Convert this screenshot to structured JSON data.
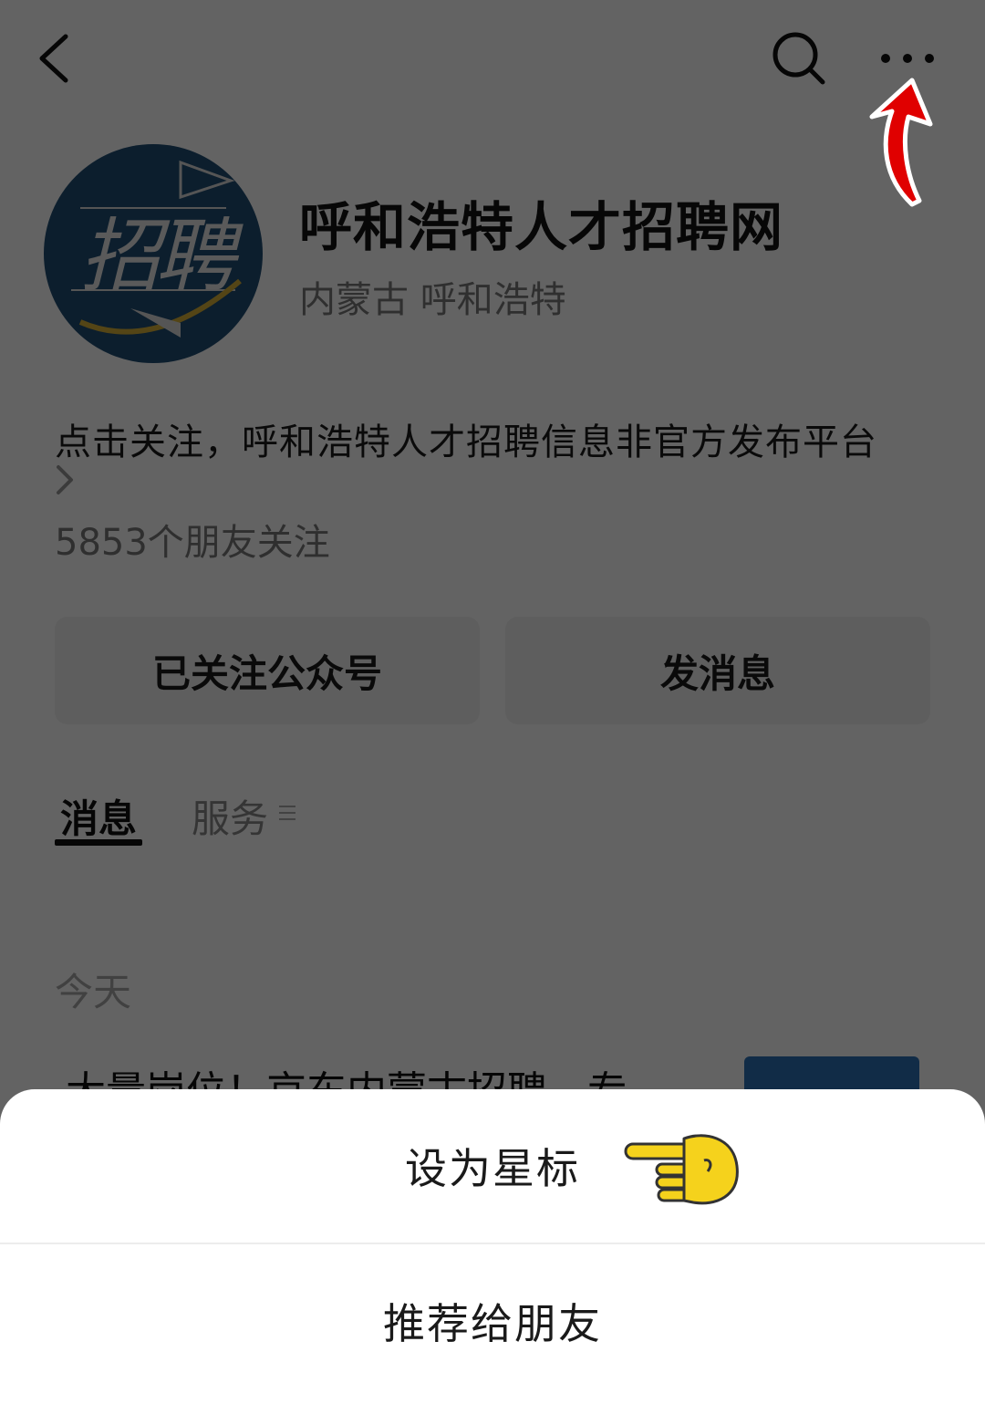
{
  "account": {
    "name": "呼和浩特人才招聘网",
    "region": "内蒙古 呼和浩特",
    "description": "点击关注，呼和浩特人才招聘信息非官方发布平台",
    "followers": "5853个朋友关注",
    "avatar_text": "招聘"
  },
  "buttons": {
    "followed": "已关注公众号",
    "message": "发消息"
  },
  "tabs": [
    {
      "label": "消息",
      "active": true
    },
    {
      "label": "服务",
      "active": false
    }
  ],
  "feed": {
    "date_label": "今天",
    "first_article_title": "大量岗位！京东内蒙古招聘，专"
  },
  "sheet": {
    "items": [
      {
        "label": "设为星标"
      },
      {
        "label": "推荐给朋友"
      }
    ]
  },
  "icons": [
    "back-icon",
    "search-icon",
    "more-icon",
    "chevron-right-icon",
    "menu-icon",
    "red-arrow-annotation",
    "pointing-hand-icon"
  ],
  "colors": {
    "overlay": "rgba(0,0,0,0.61)",
    "annotation_arrow": "#e00000",
    "hand": "#f5d21c",
    "avatar_bg": "#1f4d74"
  }
}
